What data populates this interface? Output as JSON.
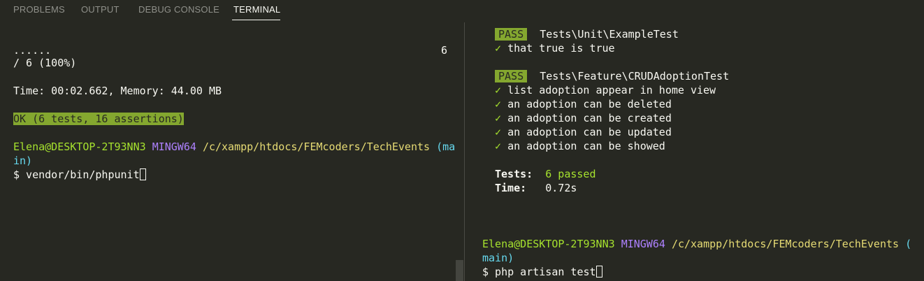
{
  "tabs": [
    {
      "label": "PROBLEMS"
    },
    {
      "label": "OUTPUT"
    },
    {
      "label": "DEBUG CONSOLE"
    },
    {
      "label": "TERMINAL"
    }
  ],
  "left": {
    "dots": "......",
    "dots_count": "6",
    "progress": "/ 6 (100%)",
    "time_memory": "Time: 00:02.662, Memory: 44.00 MB",
    "ok": "OK (6 tests, 16 assertions)",
    "prompt_user": "Elena@DESKTOP-2T93NN3",
    "prompt_env": "MINGW64",
    "prompt_path": "/c/xampp/htdocs/FEMcoders/TechEvents",
    "prompt_branch_1": "(ma",
    "prompt_branch_2": "in)",
    "command": "$ vendor/bin/phpunit"
  },
  "right": {
    "pass_label_1": "PASS",
    "suite_1": "Tests\\Unit\\ExampleTest",
    "check_1": "✓",
    "test_1": "that true is true",
    "pass_label_2": "PASS",
    "suite_2": "Tests\\Feature\\CRUDAdoptionTest",
    "tests_2": [
      "list adoption appear in home view",
      "an adoption can be deleted",
      "an adoption can be created",
      "an adoption can be updated",
      "an adoption can be showed"
    ],
    "check_mark": "✓",
    "summary_tests_label": "Tests:",
    "summary_tests_value": "6 passed",
    "summary_time_label": "Time:",
    "summary_time_value": "0.72s",
    "prompt_user": "Elena@DESKTOP-2T93NN3",
    "prompt_env": "MINGW64",
    "prompt_path": "/c/xampp/htdocs/FEMcoders/TechEvents",
    "prompt_branch_1": "(",
    "prompt_branch_2": "main)",
    "command": "$ php artisan test"
  },
  "colors": {
    "background": "#272822",
    "pass_badge": "#84a72f",
    "green": "#a6e22e",
    "purple": "#ae81ff",
    "yellow": "#e6db74",
    "cyan": "#66d9ef"
  }
}
